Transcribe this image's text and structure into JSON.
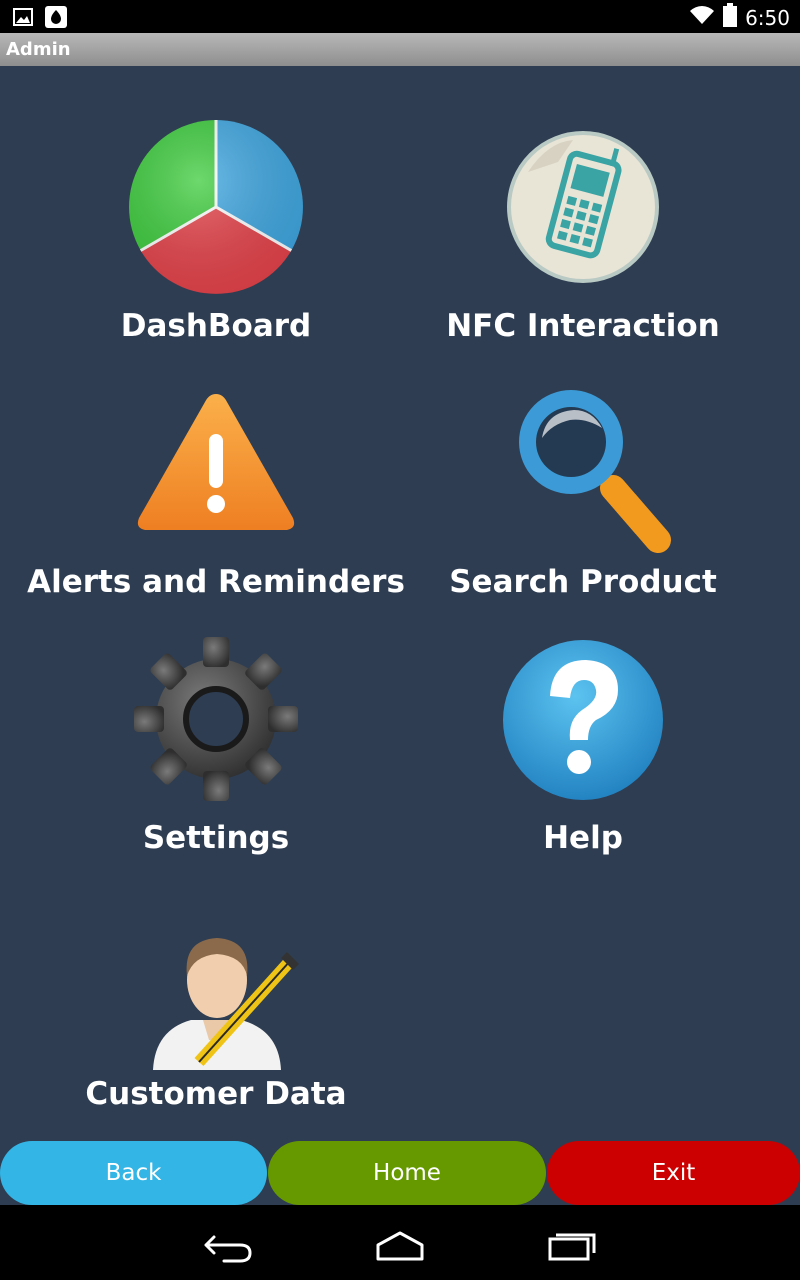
{
  "status_bar": {
    "time": "6:50",
    "icons_left": [
      "image-notification-icon",
      "app-notification-icon"
    ],
    "icons_right": [
      "wifi-icon",
      "battery-icon"
    ]
  },
  "titlebar": {
    "title": "Admin"
  },
  "menu": {
    "items": [
      {
        "label": "DashBoard",
        "icon": "pie-chart-icon"
      },
      {
        "label": "NFC Interaction",
        "icon": "nfc-phone-icon"
      },
      {
        "label": "Alerts and Reminders",
        "icon": "warning-icon"
      },
      {
        "label": "Search Product",
        "icon": "magnifier-icon"
      },
      {
        "label": "Settings",
        "icon": "gear-icon"
      },
      {
        "label": "Help",
        "icon": "help-icon"
      },
      {
        "label": "Customer Data",
        "icon": "user-edit-icon"
      }
    ]
  },
  "buttons": {
    "back": "Back",
    "home": "Home",
    "exit": "Exit"
  },
  "colors": {
    "background": "#2e3d52",
    "back": "#33b5e5",
    "home": "#669900",
    "exit": "#cc0000"
  },
  "navbar": {
    "icons": [
      "back-nav-icon",
      "home-nav-icon",
      "recents-nav-icon"
    ]
  }
}
